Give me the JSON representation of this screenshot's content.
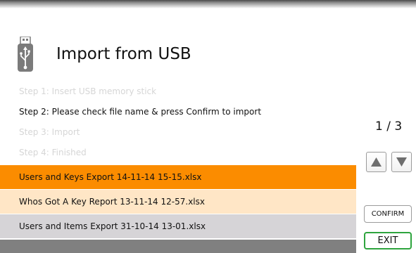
{
  "header": {
    "title": "Import from USB",
    "icon": "usb-stick-icon"
  },
  "steps": [
    {
      "label": "Step 1: Insert USB memory stick",
      "state": "inactive"
    },
    {
      "label": "Step 2: Please check file name & press Confirm to import",
      "state": "active"
    },
    {
      "label": "Step 3: Import",
      "state": "inactive"
    },
    {
      "label": "Step 4: Finished",
      "state": "inactive"
    }
  ],
  "pagination": {
    "indicator": "1 / 3",
    "up_icon": "arrow-up-icon",
    "down_icon": "arrow-down-icon"
  },
  "files": [
    {
      "name": "Users and Keys Export 14-11-14 15-15.xlsx",
      "state": "selected",
      "color": "#fb8c00"
    },
    {
      "name": "Whos Got A Key Report 13-11-14 12-57.xlsx",
      "state": "normal",
      "color": "#ffe6c6"
    },
    {
      "name": "Users and Items Export 31-10-14 13-01.xlsx",
      "state": "normal",
      "color": "#d6d4d7"
    },
    {
      "name": "",
      "state": "empty",
      "color": "#808080"
    }
  ],
  "buttons": {
    "confirm_label": "CONFIRM",
    "exit_label": "EXIT"
  },
  "colors": {
    "accent": "#fb8c00",
    "exit_border": "#2ea43e",
    "icon_gray": "#7b7b7b"
  }
}
